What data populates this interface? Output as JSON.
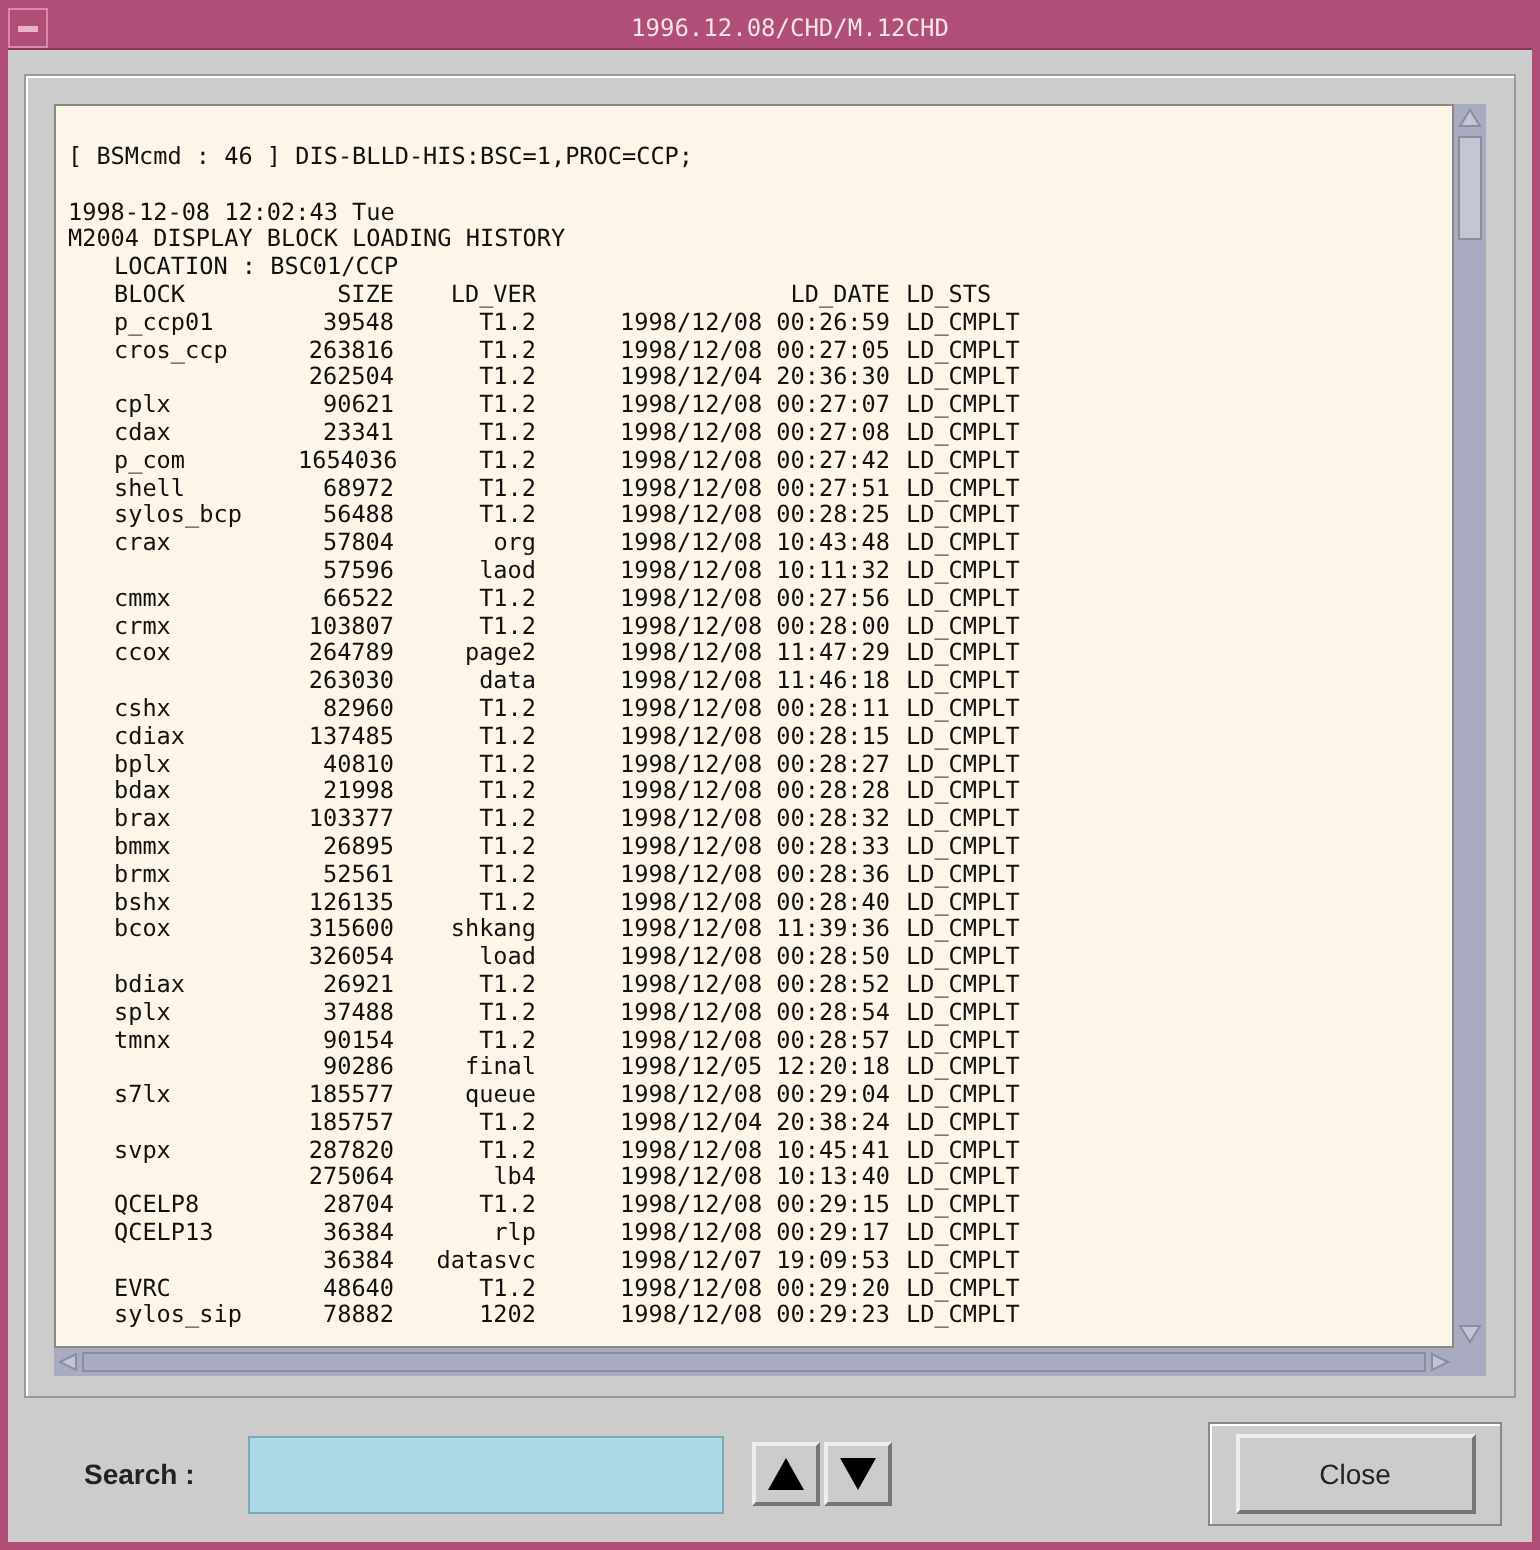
{
  "window": {
    "title": "1996.12.08/CHD/M.12CHD"
  },
  "output": {
    "command": "[ BSMcmd : 46 ] DIS-BLLD-HIS:BSC=1,PROC=CCP;",
    "timestamp": "1998-12-08 12:02:43 Tue",
    "heading": "M2004 DISPLAY BLOCK LOADING HISTORY",
    "location": "LOCATION : BSC01/CCP"
  },
  "table": {
    "columns": [
      "BLOCK",
      "SIZE",
      "LD_VER",
      "LD_DATE",
      "LD_STS"
    ],
    "rows": [
      {
        "block": "p_ccp01",
        "size": "39548",
        "ld_ver": "T1.2",
        "ld_date": "1998/12/08 00:26:59",
        "ld_sts": "LD_CMPLT"
      },
      {
        "block": "cros_ccp",
        "size": "263816",
        "ld_ver": "T1.2",
        "ld_date": "1998/12/08 00:27:05",
        "ld_sts": "LD_CMPLT"
      },
      {
        "size": "262504",
        "ld_ver": "T1.2",
        "ld_date": "1998/12/04 20:36:30",
        "ld_sts": "LD_CMPLT"
      },
      {
        "block": "cplx",
        "size": "90621",
        "ld_ver": "T1.2",
        "ld_date": "1998/12/08 00:27:07",
        "ld_sts": "LD_CMPLT"
      },
      {
        "block": "cdax",
        "size": "23341",
        "ld_ver": "T1.2",
        "ld_date": "1998/12/08 00:27:08",
        "ld_sts": "LD_CMPLT"
      },
      {
        "block": "p_com",
        "size": "1654036",
        "ld_ver": "T1.2",
        "ld_date": "1998/12/08 00:27:42",
        "ld_sts": "LD_CMPLT"
      },
      {
        "block": "shell",
        "size": "68972",
        "ld_ver": "T1.2",
        "ld_date": "1998/12/08 00:27:51",
        "ld_sts": "LD_CMPLT"
      },
      {
        "block": "sylos_bcp",
        "size": "56488",
        "ld_ver": "T1.2",
        "ld_date": "1998/12/08 00:28:25",
        "ld_sts": "LD_CMPLT"
      },
      {
        "block": "crax",
        "size": "57804",
        "ld_ver": "org",
        "ld_date": "1998/12/08 10:43:48",
        "ld_sts": "LD_CMPLT"
      },
      {
        "size": "57596",
        "ld_ver": "laod",
        "ld_date": "1998/12/08 10:11:32",
        "ld_sts": "LD_CMPLT"
      },
      {
        "block": "cmmx",
        "size": "66522",
        "ld_ver": "T1.2",
        "ld_date": "1998/12/08 00:27:56",
        "ld_sts": "LD_CMPLT"
      },
      {
        "block": "crmx",
        "size": "103807",
        "ld_ver": "T1.2",
        "ld_date": "1998/12/08 00:28:00",
        "ld_sts": "LD_CMPLT"
      },
      {
        "block": "ccox",
        "size": "264789",
        "ld_ver": "page2",
        "ld_date": "1998/12/08 11:47:29",
        "ld_sts": "LD_CMPLT"
      },
      {
        "size": "263030",
        "ld_ver": "data",
        "ld_date": "1998/12/08 11:46:18",
        "ld_sts": "LD_CMPLT"
      },
      {
        "block": "cshx",
        "size": "82960",
        "ld_ver": "T1.2",
        "ld_date": "1998/12/08 00:28:11",
        "ld_sts": "LD_CMPLT"
      },
      {
        "block": "cdiax",
        "size": "137485",
        "ld_ver": "T1.2",
        "ld_date": "1998/12/08 00:28:15",
        "ld_sts": "LD_CMPLT"
      },
      {
        "block": "bplx",
        "size": "40810",
        "ld_ver": "T1.2",
        "ld_date": "1998/12/08 00:28:27",
        "ld_sts": "LD_CMPLT"
      },
      {
        "block": "bdax",
        "size": "21998",
        "ld_ver": "T1.2",
        "ld_date": "1998/12/08 00:28:28",
        "ld_sts": "LD_CMPLT"
      },
      {
        "block": "brax",
        "size": "103377",
        "ld_ver": "T1.2",
        "ld_date": "1998/12/08 00:28:32",
        "ld_sts": "LD_CMPLT"
      },
      {
        "block": "bmmx",
        "size": "26895",
        "ld_ver": "T1.2",
        "ld_date": "1998/12/08 00:28:33",
        "ld_sts": "LD_CMPLT"
      },
      {
        "block": "brmx",
        "size": "52561",
        "ld_ver": "T1.2",
        "ld_date": "1998/12/08 00:28:36",
        "ld_sts": "LD_CMPLT"
      },
      {
        "block": "bshx",
        "size": "126135",
        "ld_ver": "T1.2",
        "ld_date": "1998/12/08 00:28:40",
        "ld_sts": "LD_CMPLT"
      },
      {
        "block": "bcox",
        "size": "315600",
        "ld_ver": "shkang",
        "ld_date": "1998/12/08 11:39:36",
        "ld_sts": "LD_CMPLT"
      },
      {
        "size": "326054",
        "ld_ver": "load",
        "ld_date": "1998/12/08 00:28:50",
        "ld_sts": "LD_CMPLT"
      },
      {
        "block": "bdiax",
        "size": "26921",
        "ld_ver": "T1.2",
        "ld_date": "1998/12/08 00:28:52",
        "ld_sts": "LD_CMPLT"
      },
      {
        "block": "splx",
        "size": "37488",
        "ld_ver": "T1.2",
        "ld_date": "1998/12/08 00:28:54",
        "ld_sts": "LD_CMPLT"
      },
      {
        "block": "tmnx",
        "size": "90154",
        "ld_ver": "T1.2",
        "ld_date": "1998/12/08 00:28:57",
        "ld_sts": "LD_CMPLT"
      },
      {
        "size": "90286",
        "ld_ver": "final",
        "ld_date": "1998/12/05 12:20:18",
        "ld_sts": "LD_CMPLT"
      },
      {
        "block": "s7lx",
        "size": "185577",
        "ld_ver": "queue",
        "ld_date": "1998/12/08 00:29:04",
        "ld_sts": "LD_CMPLT"
      },
      {
        "size": "185757",
        "ld_ver": "T1.2",
        "ld_date": "1998/12/04 20:38:24",
        "ld_sts": "LD_CMPLT"
      },
      {
        "block": "svpx",
        "size": "287820",
        "ld_ver": "T1.2",
        "ld_date": "1998/12/08 10:45:41",
        "ld_sts": "LD_CMPLT"
      },
      {
        "size": "275064",
        "ld_ver": "lb4",
        "ld_date": "1998/12/08 10:13:40",
        "ld_sts": "LD_CMPLT"
      },
      {
        "block": "QCELP8",
        "size": "28704",
        "ld_ver": "T1.2",
        "ld_date": "1998/12/08 00:29:15",
        "ld_sts": "LD_CMPLT"
      },
      {
        "block": "QCELP13",
        "size": "36384",
        "ld_ver": "rlp",
        "ld_date": "1998/12/08 00:29:17",
        "ld_sts": "LD_CMPLT"
      },
      {
        "size": "36384",
        "ld_ver": "datasvc",
        "ld_date": "1998/12/07 19:09:53",
        "ld_sts": "LD_CMPLT"
      },
      {
        "block": "EVRC",
        "size": "48640",
        "ld_ver": "T1.2",
        "ld_date": "1998/12/08 00:29:20",
        "ld_sts": "LD_CMPLT"
      },
      {
        "block": "sylos_sip",
        "size": "78882",
        "ld_ver": "1202",
        "ld_date": "1998/12/08 00:29:23",
        "ld_sts": "LD_CMPLT"
      }
    ]
  },
  "search": {
    "label": "Search :"
  },
  "buttons": {
    "close": "Close"
  }
}
